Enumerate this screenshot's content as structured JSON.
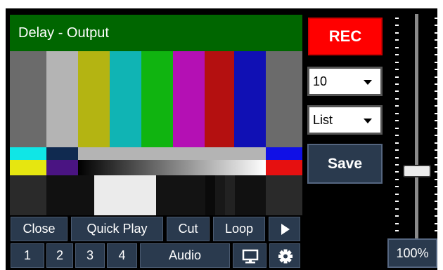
{
  "player": {
    "title": "Delay - Output"
  },
  "controls": {
    "rec_label": "REC",
    "delay_select": {
      "value": "10"
    },
    "mode_select": {
      "value": "List"
    },
    "save_label": "Save"
  },
  "toolbar": {
    "close_label": "Close",
    "quick_play_label": "Quick Play",
    "cut_label": "Cut",
    "loop_label": "Loop",
    "play_icon": "play-icon",
    "preset_1_label": "1",
    "preset_2_label": "2",
    "preset_3_label": "3",
    "preset_4_label": "4",
    "audio_label": "Audio",
    "monitor_icon": "monitor-icon",
    "settings_icon": "gear-icon"
  },
  "volume": {
    "level": 0.3,
    "zoom_label": "100%"
  },
  "colors": {
    "title_bar": "#006600",
    "rec": "#ff0000",
    "button": "#2a3a4e"
  }
}
